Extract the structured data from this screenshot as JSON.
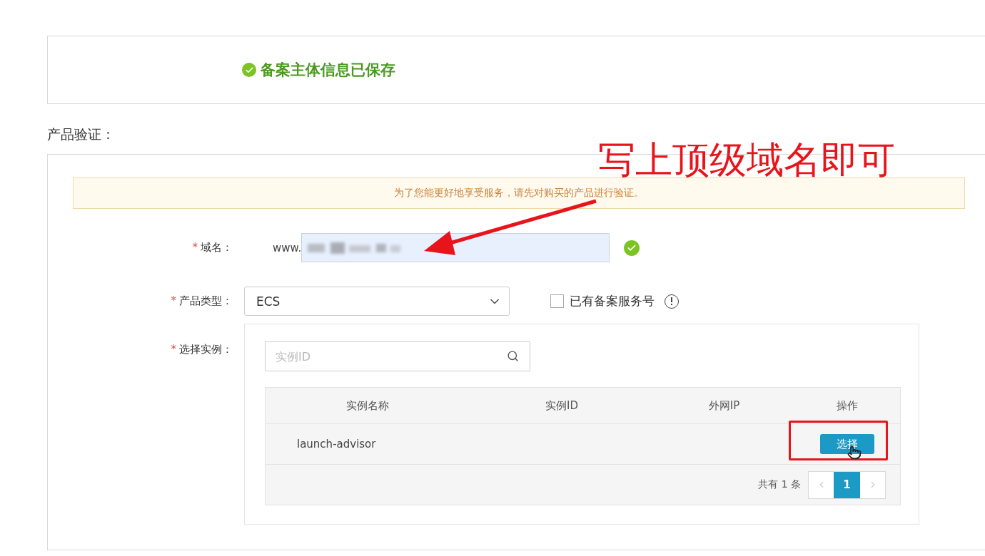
{
  "status_banner": {
    "text": "备案主体信息已保存",
    "success": true
  },
  "section_title": "产品验证：",
  "notice": "为了您能更好地享受服务，请先对购买的产品进行验证。",
  "form": {
    "domain": {
      "required_mark": "*",
      "label": "域名：",
      "prefix": "www.",
      "valid": true
    },
    "product_type": {
      "required_mark": "*",
      "label": "产品类型：",
      "value": "ECS"
    },
    "service_number": {
      "label": "已有备案服务号",
      "checked": false
    },
    "instance": {
      "required_mark": "*",
      "label": "选择实例：",
      "search": {
        "placeholder": "实例ID"
      },
      "table": {
        "columns": [
          "实例名称",
          "实例ID",
          "外网IP",
          "操作"
        ],
        "rows": [
          {
            "name": "launch-advisor",
            "action": "选择",
            "highlighted": true
          }
        ]
      },
      "pagination": {
        "total": "共有 1 条",
        "pages": [
          {
            "label": "1",
            "selected": true
          }
        ]
      }
    }
  },
  "annotation": {
    "text": "写上顶级域名即可"
  }
}
